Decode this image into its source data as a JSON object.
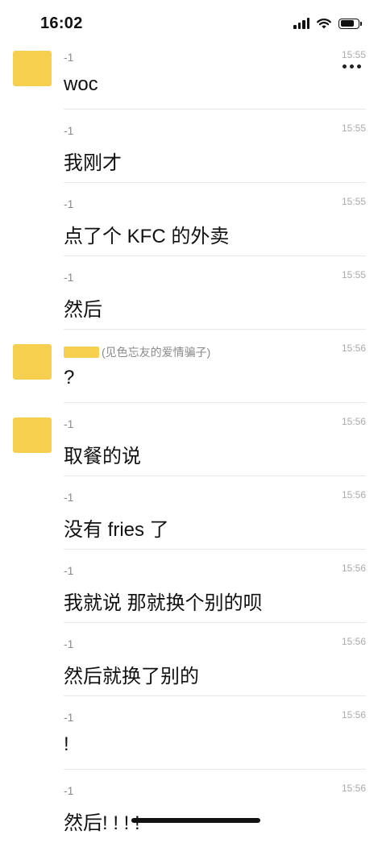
{
  "status_bar": {
    "time": "16:02"
  },
  "messages": [
    {
      "avatar": true,
      "sender": "-1",
      "time": "15:55",
      "text": "woc"
    },
    {
      "avatar": false,
      "sender": "-1",
      "time": "15:55",
      "text": "我刚才"
    },
    {
      "avatar": false,
      "sender": "-1",
      "time": "15:55",
      "text": "点了个 KFC 的外卖"
    },
    {
      "avatar": false,
      "sender": "-1",
      "time": "15:55",
      "text": "然后"
    },
    {
      "avatar": true,
      "sender": "(见色忘友的爱情骗子)",
      "time": "15:56",
      "text": "?"
    },
    {
      "avatar": true,
      "sender": "-1",
      "time": "15:56",
      "text": "取餐的说"
    },
    {
      "avatar": false,
      "sender": "-1",
      "time": "15:56",
      "text": "没有 fries 了"
    },
    {
      "avatar": false,
      "sender": "-1",
      "time": "15:56",
      "text": "我就说 那就换个别的呗"
    },
    {
      "avatar": false,
      "sender": "-1",
      "time": "15:56",
      "text": "然后就换了别的"
    },
    {
      "avatar": false,
      "sender": "-1",
      "time": "15:56",
      "text": "!"
    },
    {
      "avatar": false,
      "sender": "-1",
      "time": "15:56",
      "text": "然后! ! ! !"
    }
  ]
}
